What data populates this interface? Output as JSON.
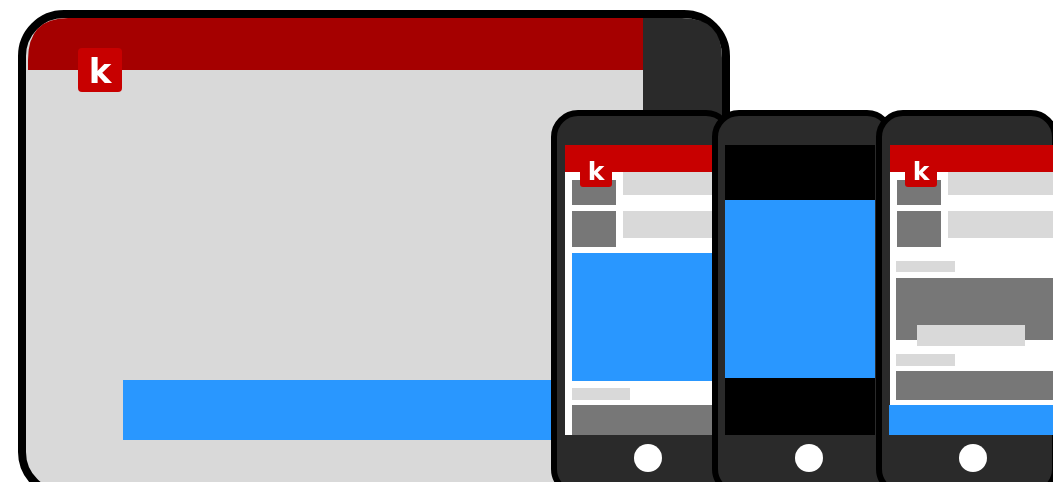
{
  "tablet": {
    "logo": "k"
  },
  "phones": [
    {
      "kind": "feed",
      "logo": "k"
    },
    {
      "kind": "video"
    },
    {
      "kind": "article",
      "logo": "k"
    }
  ]
}
